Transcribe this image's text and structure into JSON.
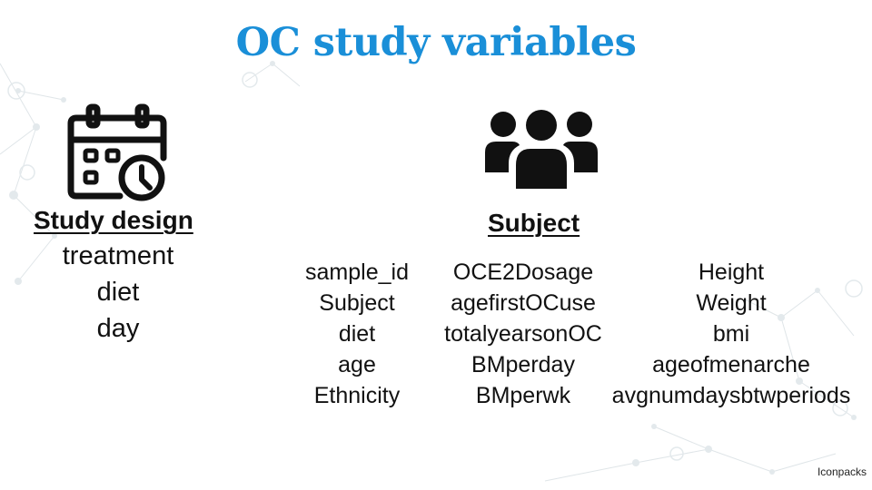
{
  "title": "OC study variables",
  "colors": {
    "title": "#1a8fd8",
    "text": "#111111",
    "network": "#cfd8dc"
  },
  "icons": {
    "design": "calendar-clock-icon",
    "subject": "people-group-icon"
  },
  "study_design": {
    "heading": "Study design",
    "items": [
      "treatment",
      "diet",
      "day"
    ]
  },
  "subject": {
    "heading": "Subject",
    "columns": [
      [
        "sample_id",
        "Subject",
        "diet",
        "age",
        "Ethnicity"
      ],
      [
        "OCE2Dosage",
        "agefirstOCuse",
        "totalyearsonOC",
        "BMperday",
        "BMperwk"
      ],
      [
        "Height",
        "Weight",
        "bmi",
        "ageofmenarche",
        "avgnumdaysbtwperiods"
      ]
    ]
  },
  "credit": "Iconpacks"
}
